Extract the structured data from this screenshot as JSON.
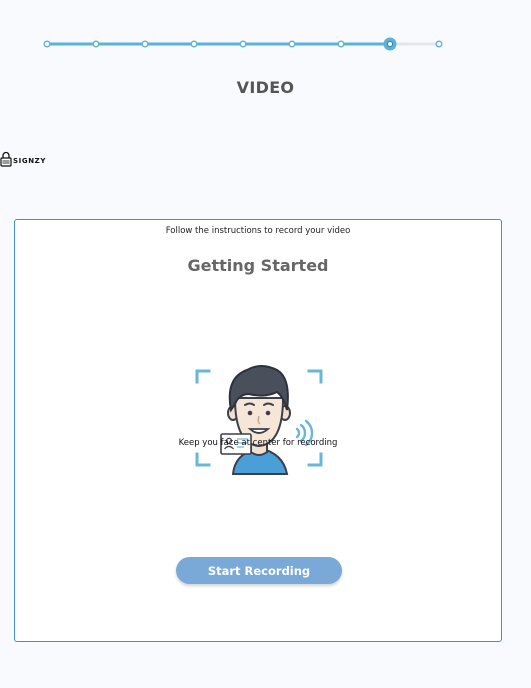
{
  "progress": {
    "total_steps": 9,
    "current_step": 8,
    "accent_color": "#5ab3d6",
    "inactive_color": "#e3e7ec"
  },
  "header": {
    "title": "VIDEO"
  },
  "brand": {
    "name": "SIGNZY",
    "icon": "lock-logo-icon"
  },
  "card": {
    "instruction": "Follow the instructions to record your video",
    "heading": "Getting Started",
    "illustration": {
      "icon": "face-scan-illustration",
      "caption": "Keep you face at center for recording"
    },
    "start_button_label": "Start Recording",
    "border_color": "#4a8fc4",
    "button_color": "#7aa9d8"
  }
}
